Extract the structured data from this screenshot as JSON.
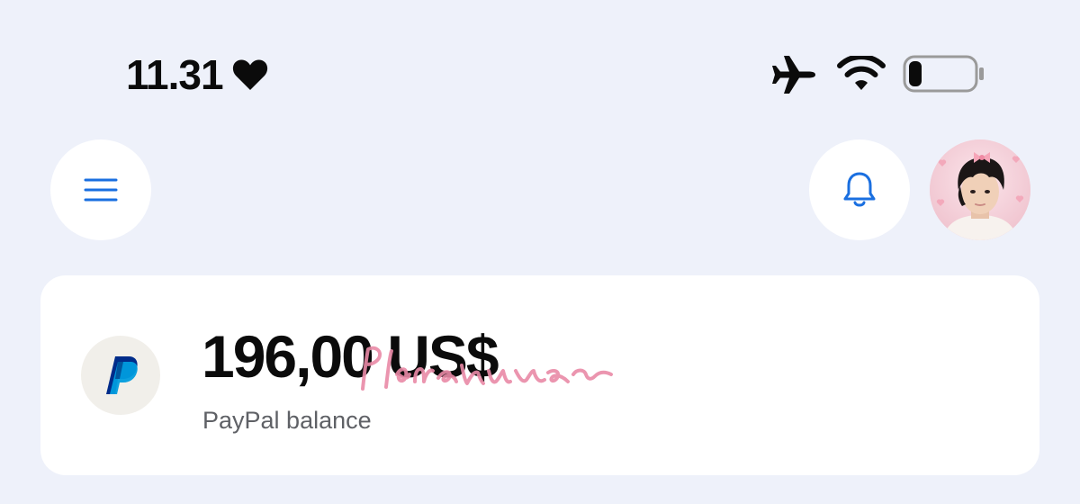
{
  "status_bar": {
    "time": "11.31",
    "icons": [
      "heart-icon",
      "airplane-icon",
      "wifi-icon",
      "battery-icon"
    ],
    "battery_level": 0.18
  },
  "top_bar": {
    "menu_icon": "hamburger-menu-icon",
    "notification_icon": "bell-icon",
    "avatar": "profile-avatar"
  },
  "balance_card": {
    "logo_icon": "paypal-logo-icon",
    "amount": "196,00 US$",
    "label": "PayPal balance",
    "handwritten_overlay": "Plathsuwa"
  },
  "colors": {
    "background": "#eef1fa",
    "card": "#ffffff",
    "accent_blue": "#1a6fe0",
    "paypal_dark_blue": "#002c8a",
    "paypal_light_blue": "#009cde",
    "watermark_pink": "#e98aa6"
  }
}
